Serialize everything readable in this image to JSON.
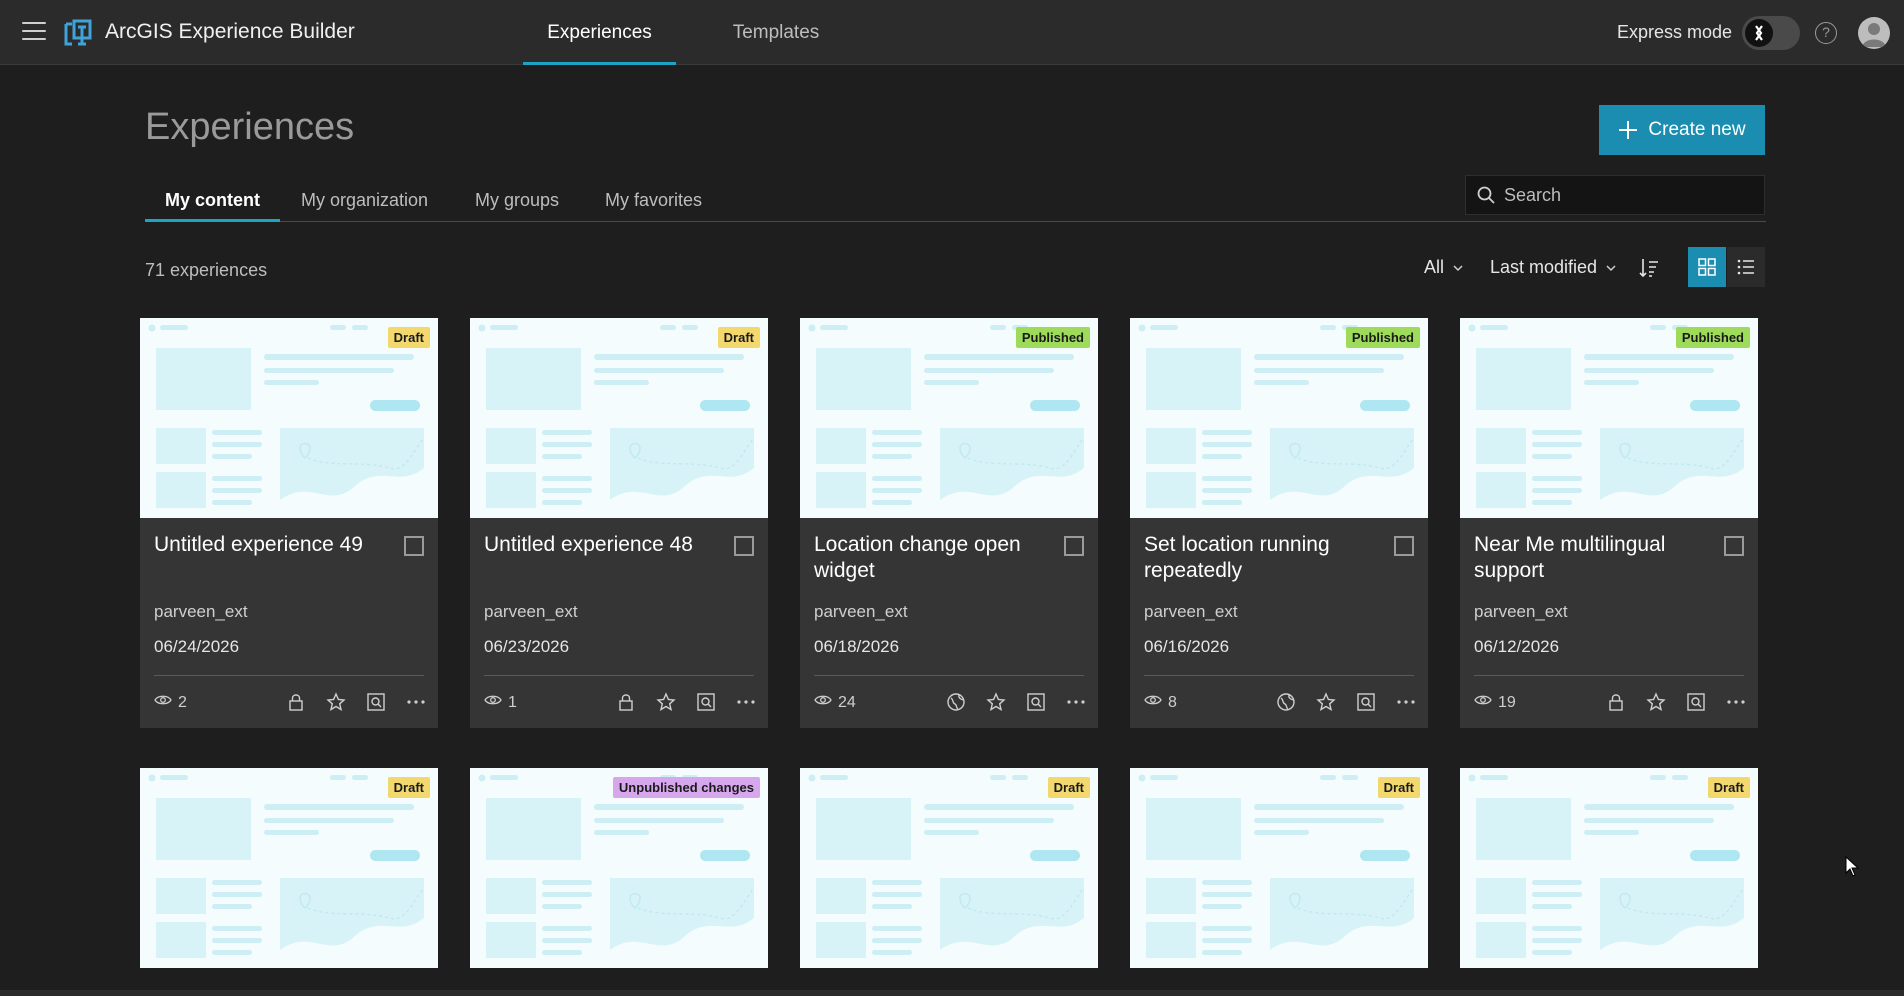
{
  "app": {
    "title": "ArcGIS Experience Builder"
  },
  "top_nav": {
    "tabs": [
      {
        "label": "Experiences",
        "active": true
      },
      {
        "label": "Templates",
        "active": false
      }
    ],
    "express_mode_label": "Express mode",
    "express_mode_on": false
  },
  "page": {
    "title": "Experiences",
    "create_label": "Create new",
    "search_placeholder": "Search",
    "subtabs": [
      {
        "label": "My content",
        "active": true
      },
      {
        "label": "My organization",
        "active": false
      },
      {
        "label": "My groups",
        "active": false
      },
      {
        "label": "My favorites",
        "active": false
      }
    ],
    "count_label": "71 experiences",
    "filter_type": "All",
    "sort_by": "Last modified",
    "view_mode": "grid"
  },
  "colors": {
    "accent": "#1a8db0",
    "draft": "#f3d86e",
    "published": "#9edb5a",
    "unpublished": "#d7a7ee"
  },
  "cards": [
    {
      "title": "Untitled experience 49",
      "status": "Draft",
      "owner": "parveen_ext",
      "date": "06/24/2026",
      "views": "2",
      "share_icon": "lock-icon"
    },
    {
      "title": "Untitled experience 48",
      "status": "Draft",
      "owner": "parveen_ext",
      "date": "06/23/2026",
      "views": "1",
      "share_icon": "lock-icon"
    },
    {
      "title": "Location change open widget",
      "status": "Published",
      "owner": "parveen_ext",
      "date": "06/18/2026",
      "views": "24",
      "share_icon": "globe-icon"
    },
    {
      "title": "Set location running repeatedly",
      "status": "Published",
      "owner": "parveen_ext",
      "date": "06/16/2026",
      "views": "8",
      "share_icon": "globe-icon"
    },
    {
      "title": "Near Me multilingual support",
      "status": "Published",
      "owner": "parveen_ext",
      "date": "06/12/2026",
      "views": "19",
      "share_icon": "lock-icon"
    },
    {
      "status": "Draft"
    },
    {
      "status": "Unpublished changes"
    },
    {
      "status": "Draft"
    },
    {
      "status": "Draft"
    },
    {
      "status": "Draft"
    }
  ]
}
